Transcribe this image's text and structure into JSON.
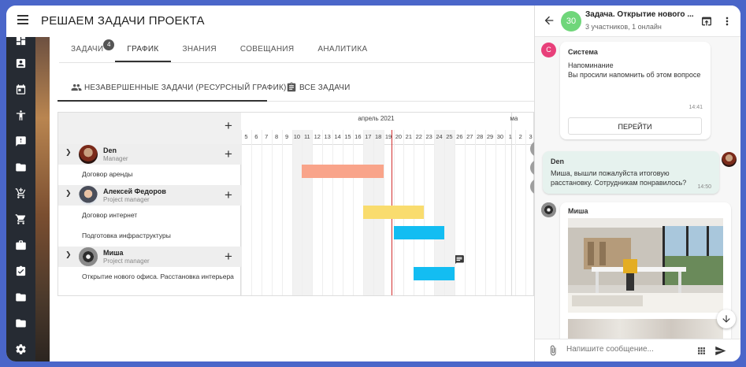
{
  "app": {
    "title": "РЕШАЕМ ЗАДАЧИ ПРОЕКТА"
  },
  "tabs": [
    {
      "label": "ЗАДАЧИ",
      "badge": "4"
    },
    {
      "label": "ГРАФИК"
    },
    {
      "label": "ЗНАНИЯ"
    },
    {
      "label": "СОВЕЩАНИЯ"
    },
    {
      "label": "АНАЛИТИКА"
    }
  ],
  "subtabs": [
    {
      "label": "НЕЗАВЕРШЕННЫЕ ЗАДАЧИ (РЕСУРСНЫЙ ГРАФИК)"
    },
    {
      "label": "ВСЕ ЗАДАЧИ"
    }
  ],
  "gantt": {
    "month": "апрель 2021",
    "next_month_partial": "ма",
    "days": [
      "5",
      "6",
      "7",
      "8",
      "9",
      "10",
      "11",
      "12",
      "13",
      "14",
      "15",
      "16",
      "17",
      "18",
      "19",
      "20",
      "21",
      "22",
      "23",
      "24",
      "25",
      "26",
      "27",
      "28",
      "29",
      "30",
      "1",
      "2",
      "3"
    ],
    "weekend_days": [
      "10",
      "11",
      "17",
      "18",
      "24",
      "25"
    ],
    "today": "19",
    "resources": [
      {
        "name": "Den",
        "role": "Manager",
        "tasks": [
          {
            "name": "Договор аренды",
            "start": "11",
            "end": "18",
            "color": "#f9a48a"
          }
        ]
      },
      {
        "name": "Алексей Федоров",
        "role": "Project manager",
        "tasks": [
          {
            "name": "Договор интернет",
            "start": "17",
            "end": "22",
            "color": "#f9dc6e"
          },
          {
            "name": "Подготовка инфраструктуры",
            "start": "20",
            "end": "24",
            "color": "#13bdf2"
          }
        ]
      },
      {
        "name": "Миша",
        "role": "Project manager",
        "tasks": [
          {
            "name": "Открытие нового офиса. Расстановка интерьера",
            "start": "22",
            "end": "25",
            "color": "#13bdf2"
          }
        ]
      }
    ]
  },
  "chat": {
    "title": "Задача. Открытие нового ...",
    "avatar_text": "30",
    "subtitle": "3 участников, 1 онлайн",
    "messages": [
      {
        "author": "Система",
        "avatar": "С",
        "lines": [
          "Напоминание",
          "Вы просили напомнить об этом вопросе"
        ],
        "time": "14:41",
        "button": "ПЕРЕЙТИ"
      },
      {
        "author": "Den",
        "lines": [
          "Миша, вышли пожалуйста итоговую",
          "расстановку. Сотрудникам понравилось?"
        ],
        "time": "14:50"
      },
      {
        "author": "Миша"
      }
    ],
    "input_placeholder": "Напишите сообщение..."
  },
  "colors": {
    "accent": "#4a66c9",
    "sidebar": "#262b33",
    "today_line": "#d32f2f",
    "own_message": "#e6f2ee"
  }
}
